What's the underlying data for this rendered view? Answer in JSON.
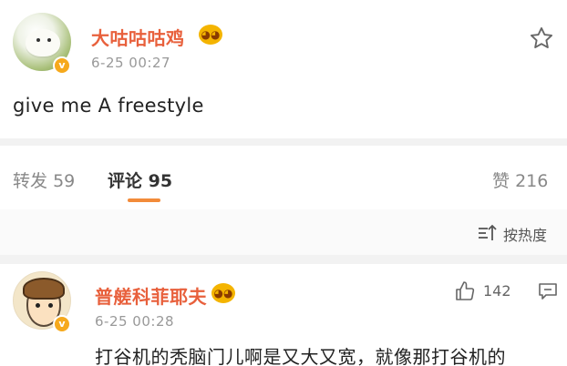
{
  "post": {
    "username": "大咕咕咕鸡",
    "timestamp": "6-25 00:27",
    "text": "give me A freestyle",
    "verified_mark": "v"
  },
  "tabs": {
    "repost_label": "转发",
    "repost_count": "59",
    "comment_label": "评论",
    "comment_count": "95",
    "like_label": "赞",
    "like_count": "216"
  },
  "sort": {
    "label": "按热度"
  },
  "comment": {
    "username": "普艖科菲耶夫",
    "timestamp": "6-25 00:28",
    "like_count": "142",
    "text": "打谷机的秃脑门儿啊是又大又宽，就像那打谷机的",
    "verified_mark": "v"
  },
  "colors": {
    "username": "#e8603c",
    "accent_underline": "#f28b3a",
    "badge": "#f6a91c"
  },
  "icons": [
    "star-icon",
    "sort-icon",
    "thumbs-up-icon",
    "reply-icon",
    "vip-badge-icon"
  ]
}
